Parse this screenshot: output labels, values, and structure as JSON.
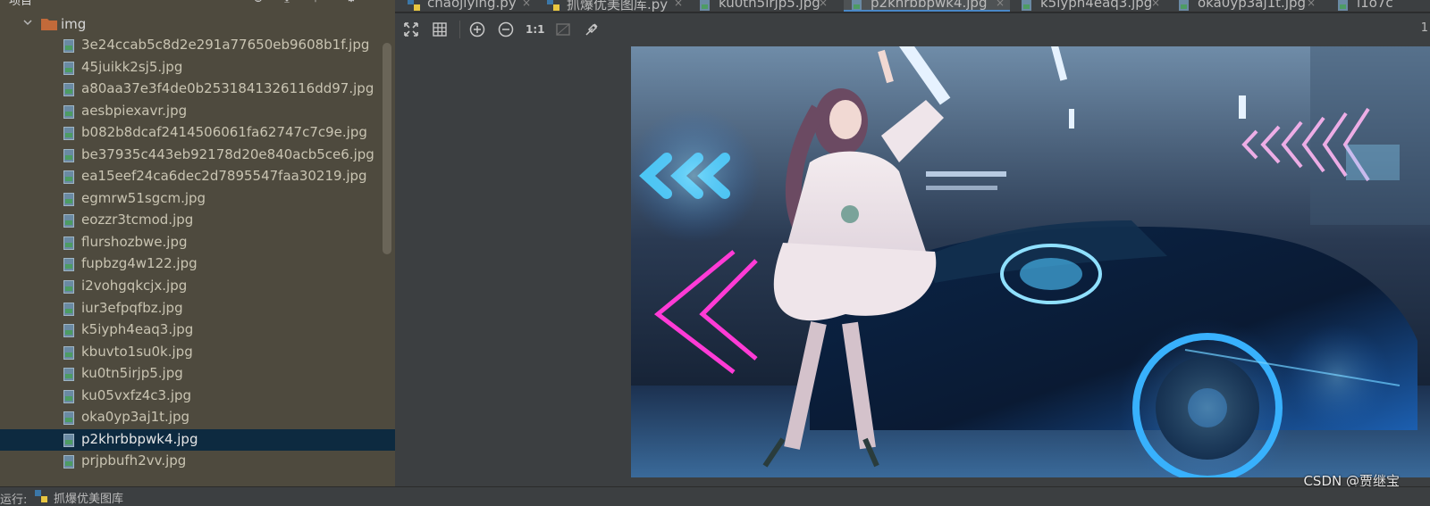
{
  "project_panel": {
    "title": "项目",
    "title_caret": "▾",
    "folder": {
      "name": "img"
    },
    "files": [
      "3e24ccab5c8d2e291a77650eb9608b1f.jpg",
      "45juikk2sj5.jpg",
      "a80aa37e3f4de0b2531841326116dd97.jpg",
      "aesbpiexavr.jpg",
      "b082b8dcaf2414506061fa62747c7c9e.jpg",
      "be37935c443eb92178d20e840acb5ce6.jpg",
      "ea15eef24ca6dec2d7895547faa30219.jpg",
      "egmrw51sgcm.jpg",
      "eozzr3tcmod.jpg",
      "flurshozbwe.jpg",
      "fupbzg4w122.jpg",
      "i2vohgqkcjx.jpg",
      "iur3efpqfbz.jpg",
      "k5iyph4eaq3.jpg",
      "kbuvto1su0k.jpg",
      "ku0tn5irjp5.jpg",
      "ku05vxfz4c3.jpg",
      "oka0yp3aj1t.jpg",
      "p2khrbbpwk4.jpg",
      "prjpbufh2vv.jpg"
    ],
    "selected_file": "p2khrbbpwk4.jpg"
  },
  "tabs": [
    {
      "label": "chaojiying.py",
      "icon": "python-file-icon"
    },
    {
      "label": "抓爆优美图库.py",
      "icon": "python-file-icon"
    },
    {
      "label": "ku0tn5irjp5.jpg",
      "icon": "image-file-icon"
    },
    {
      "label": "p2khrbbpwk4.jpg",
      "icon": "image-file-icon",
      "active": true
    },
    {
      "label": "k5iyph4eaq3.jpg",
      "icon": "image-file-icon"
    },
    {
      "label": "oka0yp3aj1t.jpg",
      "icon": "image-file-icon"
    },
    {
      "label": "i1o7c",
      "icon": "image-file-icon"
    }
  ],
  "viewer": {
    "toolbar": {
      "fit": "fit-to-window-icon",
      "grid": "grid-icon",
      "zoom_in": "zoom-in-icon",
      "zoom_out": "zoom-out-icon",
      "actual_size": "1:1",
      "chessboard": "chessboard-icon",
      "color_picker": "eyedropper-icon"
    },
    "zoom_readout": "1"
  },
  "bottom_bar": {
    "prefix": "运行:",
    "run_config": "抓爆优美图库"
  },
  "watermark": "CSDN @贾继宝",
  "colors": {
    "panel_bg": "#4e4a3e",
    "selected_row": "#0d2a40",
    "editor_bg": "#3c3f41",
    "tab_active_underline": "#4a88c7"
  }
}
